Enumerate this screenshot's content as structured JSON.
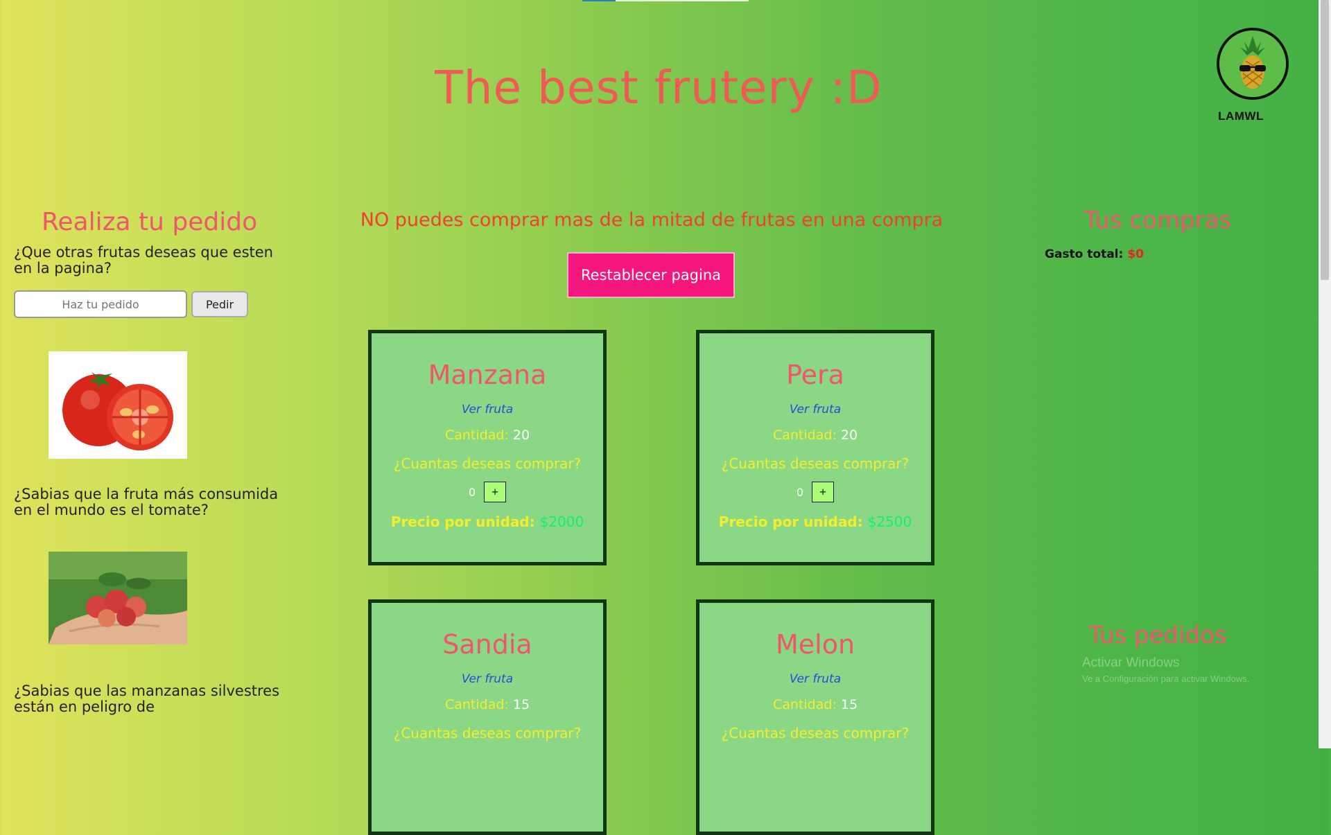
{
  "site": {
    "title": "The best frutery :D"
  },
  "user": {
    "name": "LAMWL",
    "avatar_icon": "pineapple-with-sunglasses-icon"
  },
  "order_panel": {
    "title": "Realiza tu pedido",
    "question": "¿Que otras frutas deseas que esten en la pagina?",
    "input_placeholder": "Haz tu pedido",
    "input_value": "",
    "submit_label": "Pedir"
  },
  "facts": [
    {
      "image_icon": "tomato-image",
      "text": "¿Sabias que la fruta más consumida en el mundo es el tomate?"
    },
    {
      "image_icon": "wild-apples-image",
      "text": "¿Sabias que las manzanas silvestres están en peligro de"
    }
  ],
  "main": {
    "warning": "NO puedes comprar mas de la mitad de frutas en una compra",
    "reset_label": "Restablecer pagina"
  },
  "fruits": [
    {
      "name": "Manzana",
      "link": "Ver fruta",
      "qty_label": "Cantidad:",
      "qty": "20",
      "ask": "¿Cuantas deseas comprar?",
      "selected": "0",
      "plus": "+",
      "price_label": "Precio por unidad:",
      "price": "$2000"
    },
    {
      "name": "Pera",
      "link": "Ver fruta",
      "qty_label": "Cantidad:",
      "qty": "20",
      "ask": "¿Cuantas deseas comprar?",
      "selected": "0",
      "plus": "+",
      "price_label": "Precio por unidad:",
      "price": "$2500"
    },
    {
      "name": "Sandia",
      "link": "Ver fruta",
      "qty_label": "Cantidad:",
      "qty": "15",
      "ask": "¿Cuantas deseas comprar?"
    },
    {
      "name": "Melon",
      "link": "Ver fruta",
      "qty_label": "Cantidad:",
      "qty": "15",
      "ask": "¿Cuantas deseas comprar?"
    }
  ],
  "purchases": {
    "title": "Tus compras",
    "total_label": "Gasto total:",
    "total_value": "$0"
  },
  "orders": {
    "title": "Tus pedidos"
  },
  "windows_watermark": {
    "line1": "Activar Windows",
    "line2": "Ve a Configuración para activar Windows."
  },
  "colors": {
    "title": "#ef5a55",
    "heading_pink": "#f0566b",
    "warning_red": "#f03f2f",
    "reset_button": "#f5167e",
    "card_bg": "#8ad885",
    "card_border": "#123514",
    "yellow_text": "#f4ef2a",
    "price_green": "#13ee6d",
    "link_blue": "#2a49d8"
  }
}
